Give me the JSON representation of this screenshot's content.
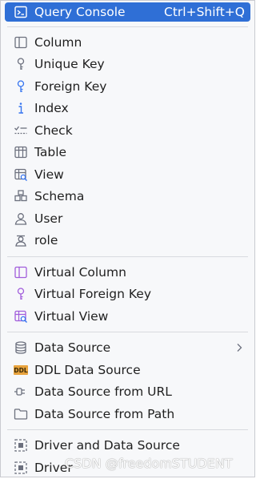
{
  "menu": {
    "query_console": {
      "label": "Query Console",
      "shortcut": "Ctrl+Shift+Q",
      "icon": "query-console-icon"
    },
    "group1": [
      {
        "label": "Column",
        "icon": "column-icon"
      },
      {
        "label": "Unique Key",
        "icon": "key-icon"
      },
      {
        "label": "Foreign Key",
        "icon": "foreign-key-icon"
      },
      {
        "label": "Index",
        "icon": "index-icon"
      },
      {
        "label": "Check",
        "icon": "check-icon"
      },
      {
        "label": "Table",
        "icon": "table-icon"
      },
      {
        "label": "View",
        "icon": "view-icon"
      },
      {
        "label": "Schema",
        "icon": "schema-icon"
      },
      {
        "label": "User",
        "icon": "user-icon"
      },
      {
        "label": "role",
        "icon": "role-icon"
      }
    ],
    "group2": [
      {
        "label": "Virtual Column",
        "icon": "virtual-column-icon"
      },
      {
        "label": "Virtual Foreign Key",
        "icon": "virtual-foreign-key-icon"
      },
      {
        "label": "Virtual View",
        "icon": "virtual-view-icon"
      }
    ],
    "group3": [
      {
        "label": "Data Source",
        "icon": "database-icon",
        "submenu": true
      },
      {
        "label": "DDL Data Source",
        "icon": "ddl-icon",
        "icon_text": "DDL"
      },
      {
        "label": "Data Source from URL",
        "icon": "plug-icon"
      },
      {
        "label": "Data Source from Path",
        "icon": "folder-icon"
      }
    ],
    "group4": [
      {
        "label": "Driver and Data Source",
        "icon": "driver-data-source-icon"
      },
      {
        "label": "Driver",
        "icon": "driver-icon"
      }
    ]
  },
  "watermark": "CSDN @freedomSTUDENT",
  "colors": {
    "selection": "#2f6fd6",
    "blue_icon": "#3574f0",
    "purple_icon": "#a15ddb",
    "gray_icon": "#6c707e",
    "ddl_orange": "#e8a33d"
  }
}
